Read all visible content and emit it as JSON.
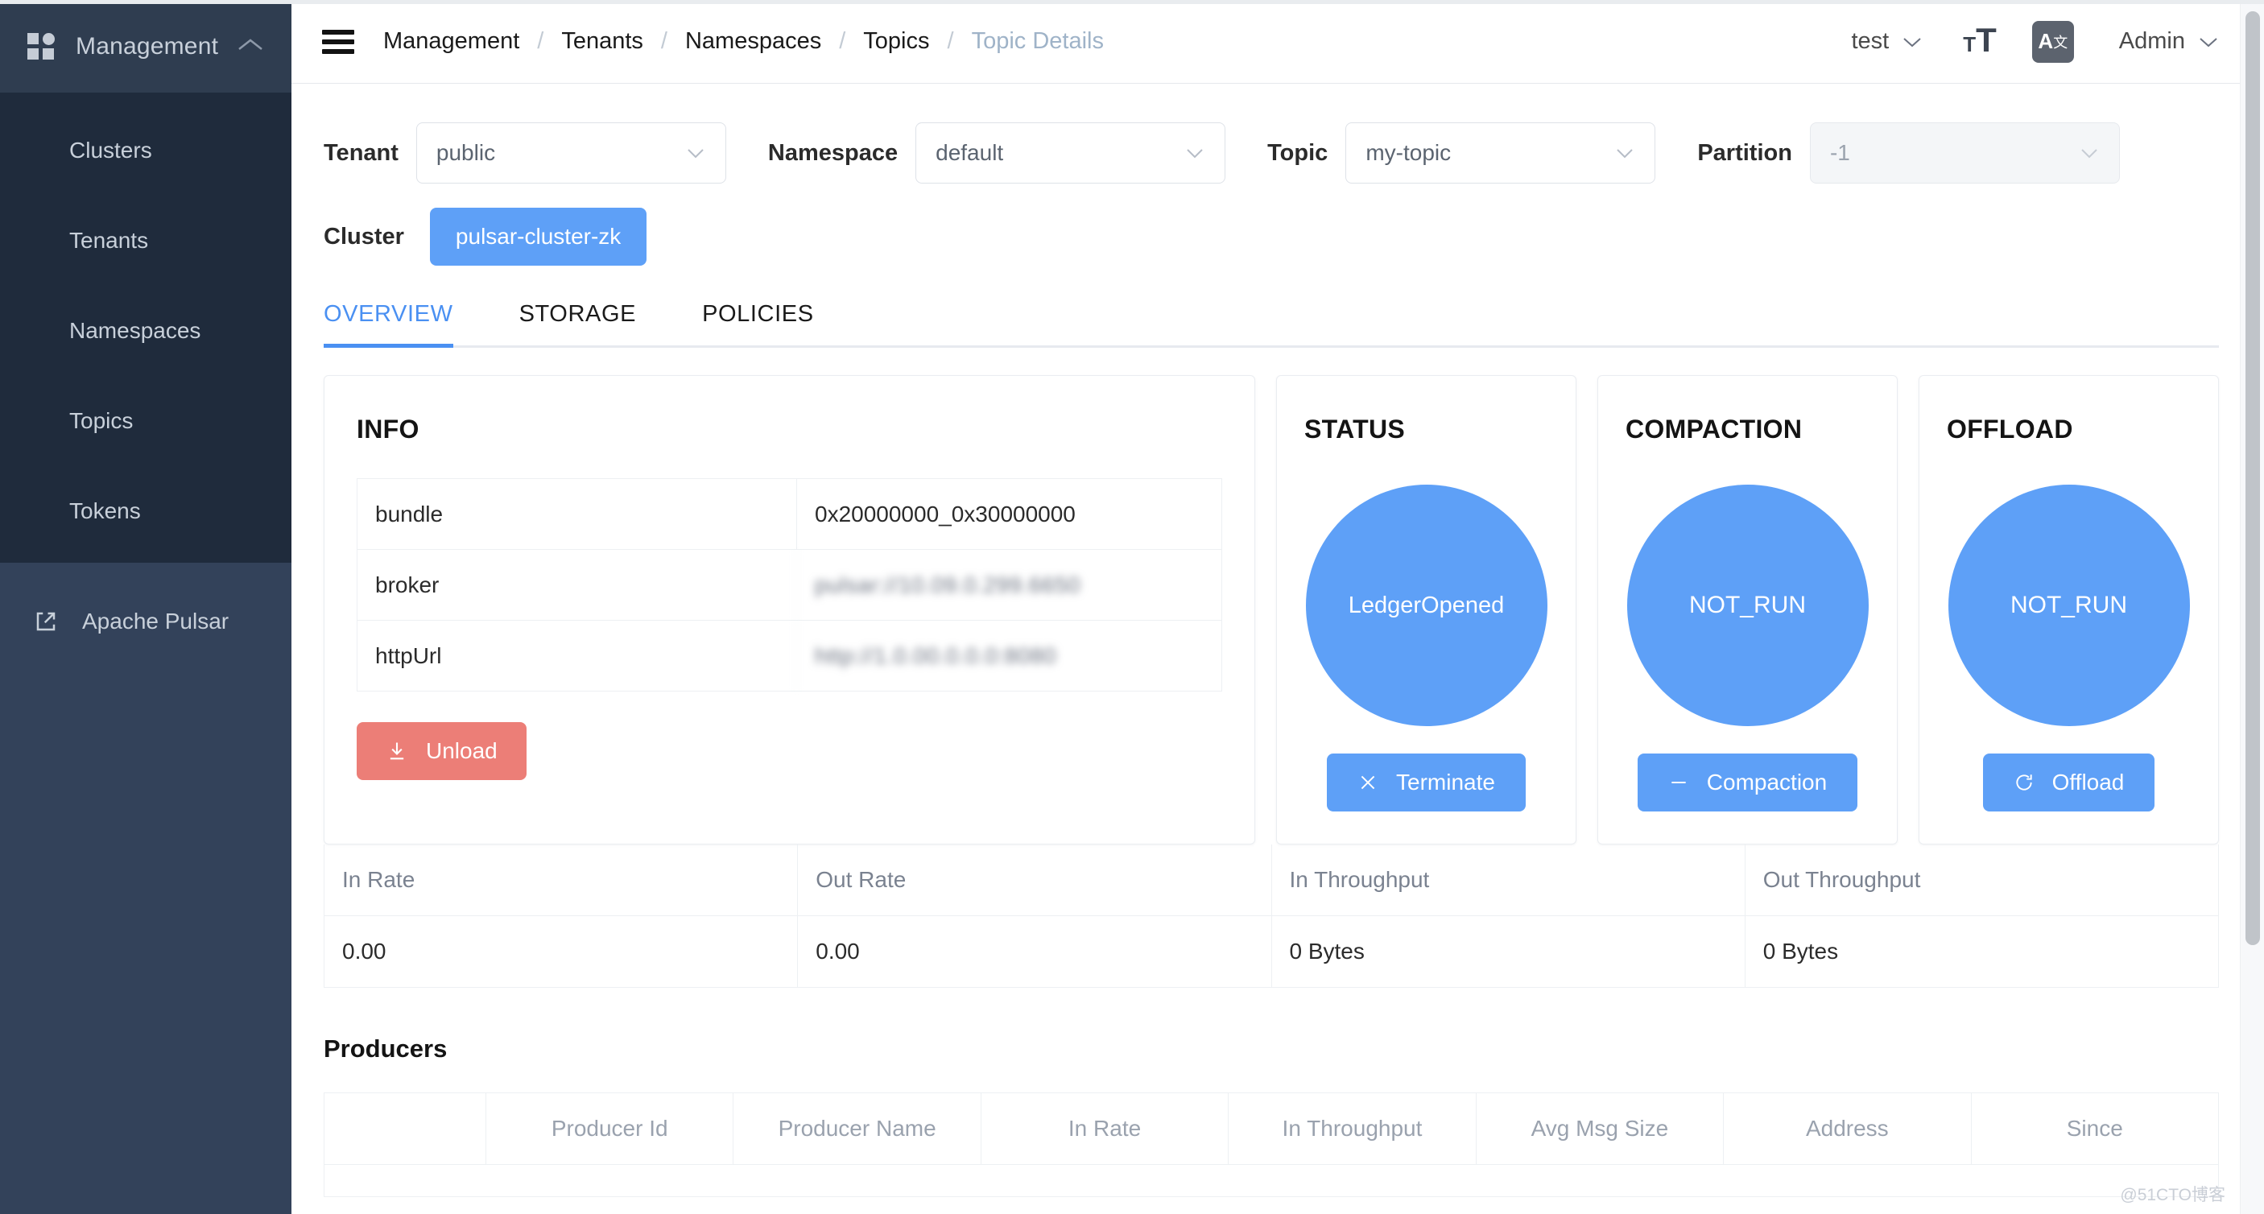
{
  "sidebar": {
    "logo_icon": "grid-logo-icon",
    "title": "Management",
    "collapse_icon": "chevron-up-icon",
    "items": [
      {
        "label": "Clusters"
      },
      {
        "label": "Tenants"
      },
      {
        "label": "Namespaces"
      },
      {
        "label": "Topics"
      },
      {
        "label": "Tokens"
      }
    ],
    "footer": {
      "label": "Apache Pulsar",
      "icon": "external-link-icon"
    }
  },
  "topbar": {
    "menu_icon": "hamburger-menu-icon",
    "breadcrumb": [
      {
        "label": "Management",
        "muted": false
      },
      {
        "label": "Tenants",
        "muted": false
      },
      {
        "label": "Namespaces",
        "muted": false
      },
      {
        "label": "Topics",
        "muted": false
      },
      {
        "label": "Topic Details",
        "muted": true
      }
    ],
    "separator": "/",
    "env_selector": "test",
    "font_size_icon": "font-size-icon",
    "font_size_small": "T",
    "font_size_large": "T",
    "language_icon": "translate-icon",
    "language_letter": "A",
    "language_sup": "文",
    "user_menu": "Admin",
    "chevron_icon": "chevron-down-icon"
  },
  "filters": {
    "tenant": {
      "label": "Tenant",
      "value": "public",
      "disabled": false
    },
    "namespace": {
      "label": "Namespace",
      "value": "default",
      "disabled": false
    },
    "topic": {
      "label": "Topic",
      "value": "my-topic",
      "disabled": false
    },
    "partition": {
      "label": "Partition",
      "value": "-1",
      "disabled": true
    },
    "cluster": {
      "label": "Cluster",
      "value": "pulsar-cluster-zk"
    }
  },
  "tabs": [
    {
      "label": "OVERVIEW",
      "active": true
    },
    {
      "label": "STORAGE",
      "active": false
    },
    {
      "label": "POLICIES",
      "active": false
    }
  ],
  "info_card": {
    "title": "INFO",
    "rows": [
      {
        "key": "bundle",
        "value": "0x20000000_0x30000000",
        "redacted": false
      },
      {
        "key": "broker",
        "value": "pulsar://10.09.0.299.6650",
        "redacted": true
      },
      {
        "key": "httpUrl",
        "value": "http://1.0.00.0.0.0:8080",
        "redacted": true
      }
    ],
    "unload_button": {
      "label": "Unload",
      "icon": "download-icon"
    }
  },
  "status_card": {
    "title": "STATUS",
    "bubble": "LedgerOpened",
    "button": {
      "label": "Terminate",
      "icon": "close-x-icon"
    }
  },
  "compaction_card": {
    "title": "COMPACTION",
    "bubble": "NOT_RUN",
    "button": {
      "label": "Compaction",
      "icon": "minus-icon"
    }
  },
  "offload_card": {
    "title": "OFFLOAD",
    "bubble": "NOT_RUN",
    "button": {
      "label": "Offload",
      "icon": "refresh-icon"
    }
  },
  "rate_table": {
    "headers": [
      "In Rate",
      "Out Rate",
      "In Throughput",
      "Out Throughput"
    ],
    "values": [
      "0.00",
      "0.00",
      "0 Bytes",
      "0 Bytes"
    ]
  },
  "producers": {
    "title": "Producers",
    "headers": [
      "",
      "Producer Id",
      "Producer Name",
      "In Rate",
      "In Throughput",
      "Avg Msg Size",
      "Address",
      "Since"
    ],
    "rows": []
  },
  "watermark": "@51CTO博客",
  "colors": {
    "sidebar_bg": "#1F2B3C",
    "sidebar_header_bg": "#2F3D50",
    "sidebar_footer_bg": "#33425A",
    "accent_blue": "#5EA0F7",
    "tab_active": "#4A90F2",
    "danger_red": "#EC7E77",
    "muted_text": "#9AA2AE"
  }
}
